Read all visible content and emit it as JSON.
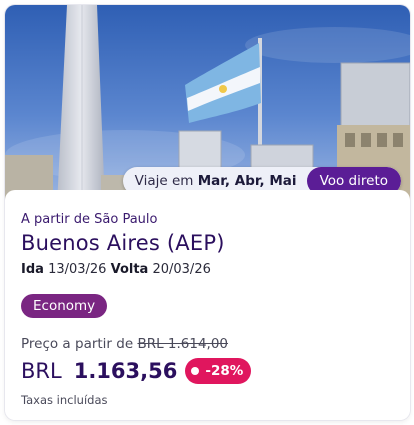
{
  "badges": {
    "travel_prefix": "Viaje em ",
    "travel_months": "Mar, Abr, Mai",
    "direct_label": "Voo direto"
  },
  "offer": {
    "origin_label": "A partir de São Paulo",
    "destination": "Buenos Aires (AEP)",
    "outbound_label": "Ida",
    "outbound_date": "13/03/26",
    "return_label": "Volta",
    "return_date": "20/03/26",
    "cabin_class": "Economy",
    "from_price_label": "Preço a partir de ",
    "old_price": "BRL 1.614,00",
    "currency": "BRL",
    "price": "1.163,56",
    "discount": "-28%",
    "taxes_note": "Taxas incluídas"
  },
  "colors": {
    "brand_purple": "#5b1d96",
    "cabin_badge": "#7a2682",
    "discount_badge": "#e0165e",
    "text_dark_purple": "#2b0f5e"
  }
}
